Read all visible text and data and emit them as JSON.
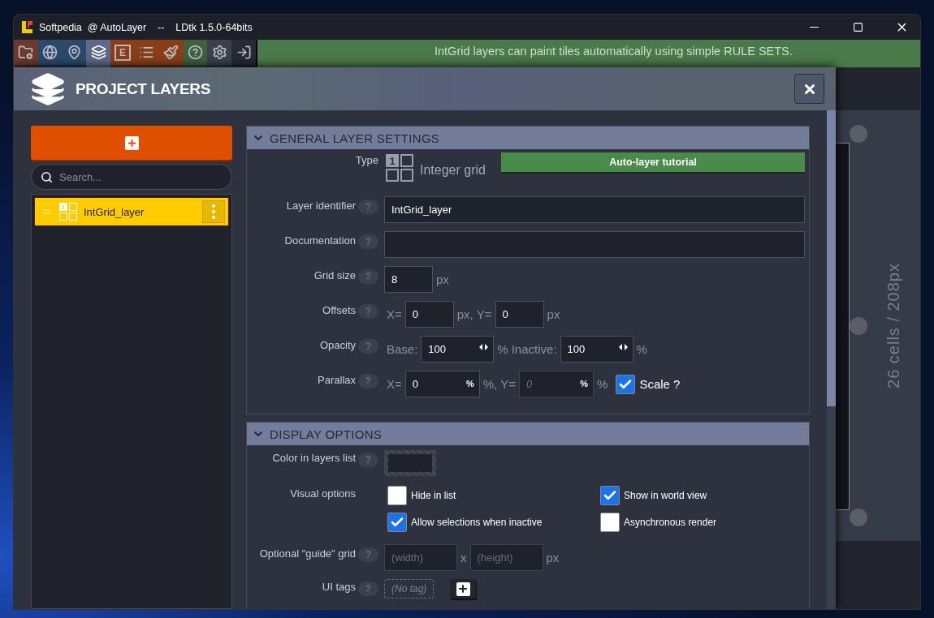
{
  "window": {
    "title": "Softpedia  @ AutoLayer    --    LDtk 1.5.0-64bits"
  },
  "toolbar": [
    {
      "kind": "project",
      "color": "#6b3a2c",
      "selected": false
    },
    {
      "kind": "world",
      "color": "#2b4a6b",
      "selected": false
    },
    {
      "kind": "levels",
      "color": "#2b4a6b",
      "selected": false
    },
    {
      "kind": "layers",
      "color": "#5e6888",
      "selected": true
    },
    {
      "kind": "entities",
      "color": "#8a3e17",
      "selected": false,
      "letter": "E"
    },
    {
      "kind": "enums",
      "color": "#8a3e17",
      "selected": false
    },
    {
      "kind": "tilesets",
      "color": "#8a3e17",
      "selected": false
    },
    {
      "kind": "help",
      "color": "#3f5f3f",
      "selected": false
    },
    {
      "kind": "settings",
      "color": "#3b404c",
      "selected": false
    },
    {
      "kind": "exit",
      "color": "#262a33",
      "selected": false
    }
  ],
  "banner": {
    "text": "IntGrid layers can paint tiles automatically using simple RULE SETS."
  },
  "canvas": {
    "size_label": "26 cells / 208px"
  },
  "dialog": {
    "title": "PROJECT LAYERS",
    "search": {
      "placeholder": "Search..."
    },
    "layers": [
      {
        "name": "IntGrid_layer",
        "icon_digit": "1",
        "selected": true
      }
    ],
    "sections": [
      {
        "title": "GENERAL LAYER SETTINGS",
        "expanded": true,
        "rows": [
          {
            "kind": "type",
            "label": "Type",
            "icon_digit": "1",
            "value": "Integer grid",
            "button": "Auto-layer tutorial"
          },
          {
            "kind": "text",
            "label": "Layer identifier",
            "help": "?",
            "value": "IntGrid_layer"
          },
          {
            "kind": "text",
            "label": "Documentation",
            "help": "?"
          },
          {
            "kind": "fields",
            "label": "Grid size",
            "help": "?",
            "fields": [
              {
                "kind": "short",
                "value": "8",
                "suffix": "px"
              }
            ]
          },
          {
            "kind": "fields",
            "label": "Offsets",
            "help": "?",
            "fields": [
              {
                "kind": "short",
                "prefix": "X=",
                "value": "0",
                "suffix": "px,"
              },
              {
                "kind": "short",
                "prefix": "Y=",
                "value": "0",
                "suffix": "px"
              }
            ]
          },
          {
            "kind": "fields",
            "label": "Opacity",
            "help": "?",
            "fields": [
              {
                "kind": "spinner",
                "prefix": "Base:",
                "value": "100",
                "suffix": "%"
              },
              {
                "kind": "spinner",
                "prefix": "Inactive:",
                "value": "100",
                "suffix": "%"
              }
            ]
          },
          {
            "kind": "fields",
            "label": "Parallax",
            "help": "?",
            "fields": [
              {
                "kind": "percent",
                "prefix": "X=",
                "value": "0",
                "unit": "%",
                "suffix": "%,"
              },
              {
                "kind": "percent",
                "prefix": "Y=",
                "placeholder": "0",
                "unit": "%",
                "suffix": "%"
              }
            ],
            "checkbox": {
              "label": "Scale ?",
              "checked": true
            }
          }
        ]
      },
      {
        "title": "DISPLAY OPTIONS",
        "expanded": true,
        "rows": [
          {
            "kind": "color",
            "label": "Color in layers list",
            "help": "?"
          },
          {
            "kind": "checkboxes",
            "label": "Visual options",
            "options": [
              {
                "label": "Hide in list",
                "checked": false
              },
              {
                "label": "Show in world view",
                "checked": true
              },
              {
                "label": "Allow selections when inactive",
                "checked": true
              },
              {
                "label": "Asynchronous render",
                "checked": false
              }
            ]
          },
          {
            "kind": "fields",
            "label": "Optional \"guide\" grid",
            "help": "?",
            "fields": [
              {
                "kind": "long",
                "placeholder": "(width)",
                "suffix": "x"
              },
              {
                "kind": "long",
                "placeholder": "(height)",
                "suffix": "px"
              }
            ]
          },
          {
            "kind": "tags",
            "label": "UI tags",
            "help": "?",
            "empty_label": "(No tag)"
          }
        ]
      }
    ]
  }
}
